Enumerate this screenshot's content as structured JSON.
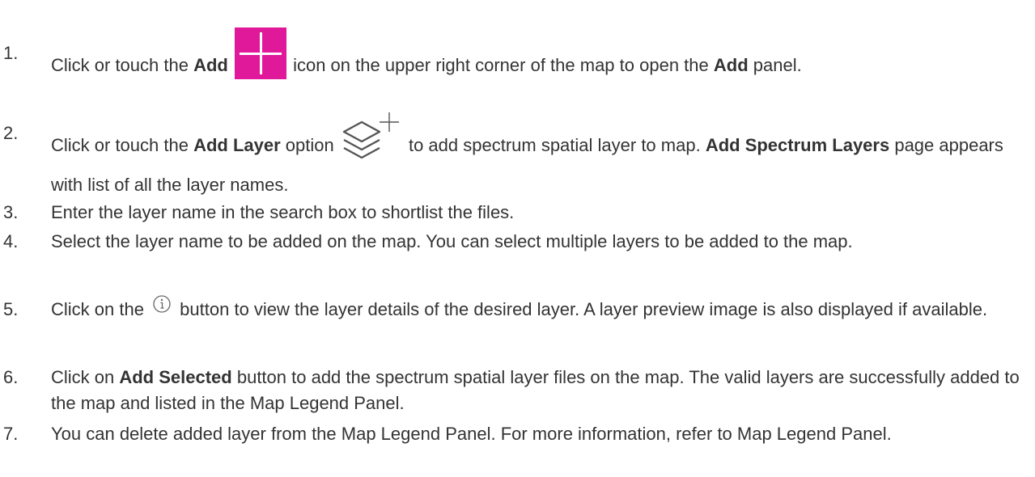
{
  "steps": [
    {
      "num": "1.",
      "t1": "Click or touch the ",
      "b1": "Add",
      "t2": " icon on the upper right corner of the map to open the ",
      "b2": "Add",
      "t3": " panel."
    },
    {
      "num": "2.",
      "t1": "Click or touch the ",
      "b1": "Add Layer",
      "t2": "  option ",
      "t3": " to add spectrum spatial layer to map. ",
      "b2": "Add Spectrum Layers",
      "t4": " page appears with list of all the layer names."
    },
    {
      "num": "3.",
      "t1": "Enter the layer name in the search box to shortlist the files."
    },
    {
      "num": "4.",
      "t1": "Select the layer name to be added on the map. You can select multiple layers to be added to the map."
    },
    {
      "num": "5.",
      "t1": "Click on the ",
      "t2": " button to view the layer details of the desired layer. A layer preview image is also displayed if available."
    },
    {
      "num": "6.",
      "t1": "Click on ",
      "b1": "Add Selected",
      "t2": " button to add the spectrum spatial layer files on the map. The valid layers are successfully added to the map and listed in the Map Legend Panel."
    },
    {
      "num": "7.",
      "t1": "You can delete added layer from the Map Legend Panel. For more information, refer to Map Legend Panel."
    }
  ],
  "icons": {
    "add": "add-icon",
    "add_color": "#e0189a",
    "layers": "add-layer-icon",
    "info": "info-icon"
  }
}
